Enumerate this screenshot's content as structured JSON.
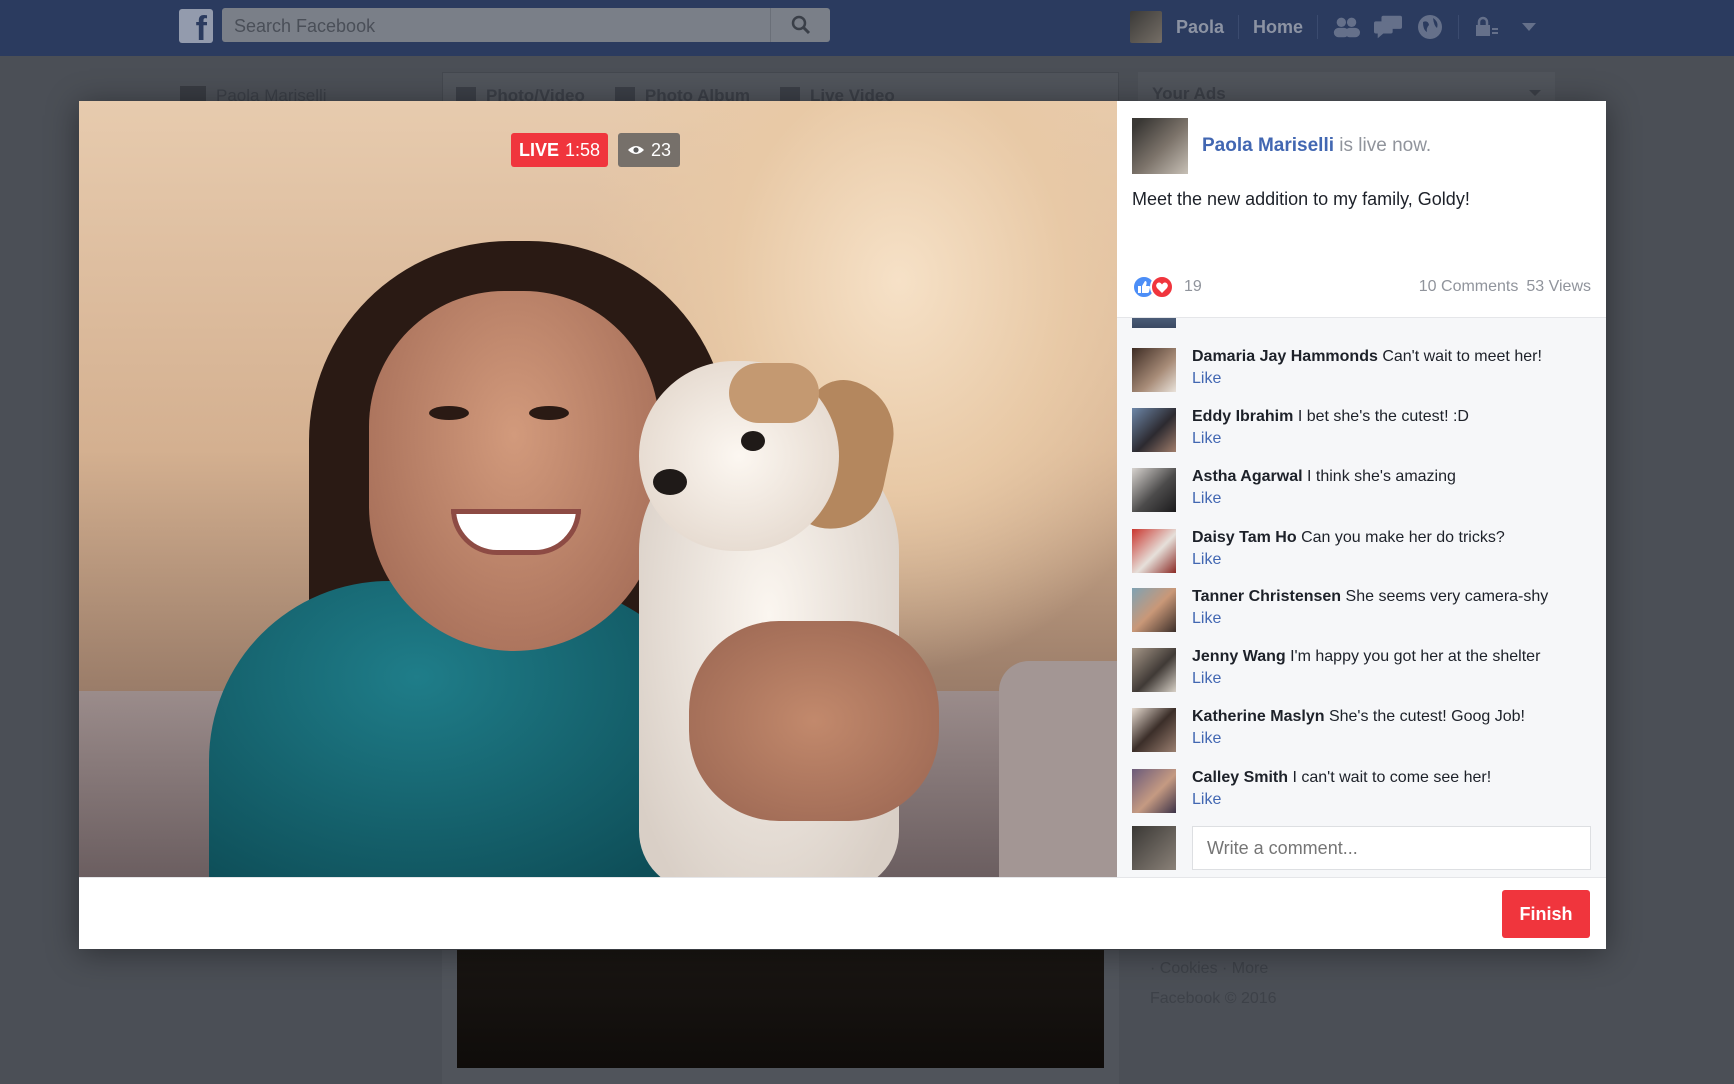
{
  "topbar": {
    "search_placeholder": "Search Facebook",
    "user_name": "Paola",
    "home_label": "Home",
    "icons": [
      "friends-icon",
      "messages-icon",
      "globe-icon",
      "privacy-lock-icon",
      "chevron-down-icon"
    ]
  },
  "background": {
    "left_user_name": "Paola Mariselli",
    "composer_tabs": [
      "Photo/Video",
      "Photo Album",
      "Live Video"
    ],
    "ads_title": "Your Ads",
    "footer_links": "· Cookies · More",
    "copyright": "Facebook © 2016"
  },
  "live": {
    "live_label": "LIVE",
    "duration": "1:58",
    "viewers": "23"
  },
  "post": {
    "author": "Paola Mariselli",
    "author_suffix": "is live now.",
    "status": "Meet the new addition to my family, Goldy!",
    "reaction_count": "19",
    "comments_count": "10 Comments",
    "views_count": "53 Views"
  },
  "comments": {
    "like_label": "Like",
    "items": [
      {
        "name": "Damaria Jay Hammonds",
        "text": "Can't wait to meet her!",
        "like": "Like"
      },
      {
        "name": "Eddy Ibrahim",
        "text": "I bet she's the cutest! :D",
        "like": "Like"
      },
      {
        "name": "Astha Agarwal",
        "text": "I think she's amazing",
        "like": "Like"
      },
      {
        "name": "Daisy Tam Ho",
        "text": "Can you make her do tricks?",
        "like": "Like"
      },
      {
        "name": "Tanner Christensen",
        "text": "She seems very camera-shy",
        "like": "Like"
      },
      {
        "name": "Jenny Wang",
        "text": "I'm happy you got her at the shelter",
        "like": "Like"
      },
      {
        "name": "Katherine Maslyn",
        "text": "She's the cutest! Goog Job!",
        "like": "Like"
      },
      {
        "name": "Calley Smith",
        "text": "I can't wait to come see her!",
        "like": "Like"
      }
    ],
    "write_placeholder": "Write a comment..."
  },
  "footer": {
    "finish_label": "Finish"
  },
  "colors": {
    "topbar": "#2b3b5f",
    "link_blue": "#4267b2",
    "live_red": "#f0353d",
    "panel_bg": "#f6f7f9"
  }
}
